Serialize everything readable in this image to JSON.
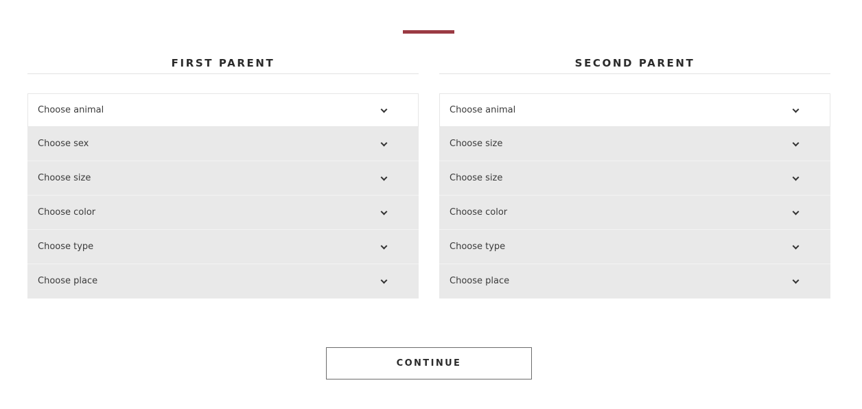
{
  "colors": {
    "accent": "#9b3a43",
    "select_bg": "#e9e9e9",
    "active_select_bg": "#ffffff",
    "text": "#333333"
  },
  "first_parent": {
    "title": "FIRST PARENT",
    "selects": [
      {
        "label": "Choose animal",
        "icon": "chevron-down-icon"
      },
      {
        "label": "Choose sex",
        "icon": "chevron-down-icon"
      },
      {
        "label": "Choose size",
        "icon": "chevron-down-icon"
      },
      {
        "label": "Choose color",
        "icon": "chevron-down-icon"
      },
      {
        "label": "Choose type",
        "icon": "chevron-down-icon"
      },
      {
        "label": "Choose place",
        "icon": "chevron-down-icon"
      }
    ]
  },
  "second_parent": {
    "title": "SECOND PARENT",
    "selects": [
      {
        "label": "Choose animal",
        "icon": "chevron-down-icon"
      },
      {
        "label": "Choose size",
        "icon": "chevron-down-icon"
      },
      {
        "label": "Choose size",
        "icon": "chevron-down-icon"
      },
      {
        "label": "Choose color",
        "icon": "chevron-down-icon"
      },
      {
        "label": "Choose type",
        "icon": "chevron-down-icon"
      },
      {
        "label": "Choose place",
        "icon": "chevron-down-icon"
      }
    ]
  },
  "actions": {
    "continue_label": "CONTINUE"
  }
}
